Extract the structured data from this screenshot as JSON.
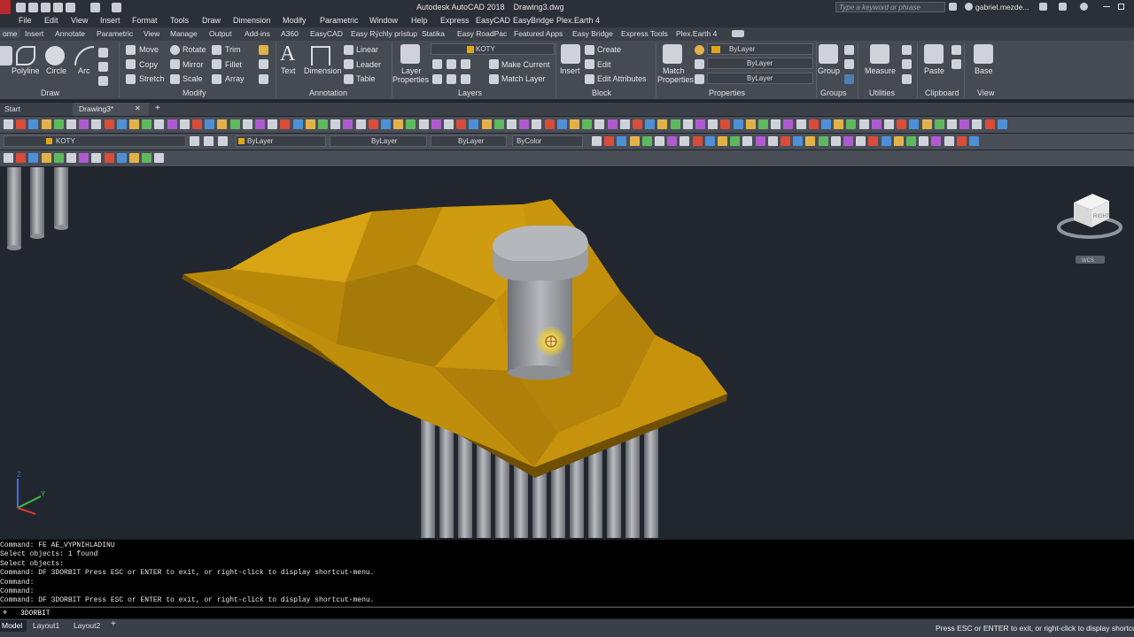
{
  "window": {
    "title": "Autodesk AutoCAD 2018    Drawing3.dwg",
    "search_placeholder": "Type a keyword or phrase",
    "username": "gabriel.mezde..."
  },
  "menu": [
    "File",
    "Edit",
    "View",
    "Insert",
    "Format",
    "Tools",
    "Draw",
    "Dimension",
    "Modify",
    "Parametric",
    "Window",
    "Help",
    "Express",
    "EasyCAD",
    "EasyBridge",
    "Plex.Earth 4"
  ],
  "ribbon_tabs": [
    "ome",
    "Insert",
    "Annotate",
    "Parametric",
    "View",
    "Manage",
    "Output",
    "Add-ins",
    "A360",
    "EasyCAD",
    "Easy Rýchly prístup",
    "Statika",
    "Easy RoadPac",
    "Featured Apps",
    "Easy Bridge",
    "Express Tools",
    "Plex.Earth 4"
  ],
  "ribbon": {
    "draw": {
      "polyline": "Polyline",
      "circle": "Circle",
      "arc": "Arc",
      "label": "Draw"
    },
    "modify": {
      "move": "Move",
      "rotate": "Rotate",
      "trim": "Trim",
      "copy": "Copy",
      "mirror": "Mirror",
      "fillet": "Fillet",
      "stretch": "Stretch",
      "scale": "Scale",
      "array": "Array",
      "label": "Modify"
    },
    "annotation": {
      "text": "Text",
      "dimension": "Dimension",
      "linear": "Linear",
      "leader": "Leader",
      "table": "Table",
      "label": "Annotation"
    },
    "layers": {
      "layer_properties_1": "Layer",
      "layer_properties_2": "Properties",
      "current_layer": "KOTY",
      "make_current": "Make Current",
      "match_layer": "Match Layer",
      "label": "Layers"
    },
    "block": {
      "insert": "Insert",
      "create": "Create",
      "edit": "Edit",
      "edit_attributes": "Edit Attributes",
      "label": "Block"
    },
    "properties": {
      "match_1": "Match",
      "match_2": "Properties",
      "color": "ByLayer",
      "linetype": "ByLayer",
      "lineweight": "ByLayer",
      "label": "Properties"
    },
    "groups": {
      "group": "Group",
      "label": "Groups"
    },
    "utilities": {
      "measure": "Measure",
      "label": "Utilities"
    },
    "clipboard": {
      "paste": "Paste",
      "label": "Clipboard"
    },
    "view": {
      "base": "Base",
      "label": "View"
    }
  },
  "doc_tabs": {
    "start": "Start",
    "drawing": "Drawing3*"
  },
  "toolbar2": {
    "layer": "KOTY",
    "color": "ByLayer",
    "linetype": "ByLayer",
    "lineweight": "ByLayer",
    "plotstyle": "ByColor"
  },
  "viewcube": {
    "face": "RIGHT",
    "wcs": "WCS"
  },
  "ucs": {
    "z": "Z",
    "y": "Y"
  },
  "command_history": [
    "Command: FE AE_VYPNIHLADINU",
    "Select objects: 1 found",
    "Select objects:",
    "Command: DF 3DORBIT Press ESC or ENTER to exit, or right-click to display shortcut-menu.",
    "Command:",
    "Command:",
    "Command: DF 3DORBIT Press ESC or ENTER to exit, or right-click to display shortcut-menu."
  ],
  "command_input": "3DORBIT",
  "layout_tabs": [
    "Model",
    "Layout1",
    "Layout2"
  ],
  "status_message": "Press ESC or ENTER to exit, or right-click to display shortcut-m",
  "colors": {
    "terrain": "#c8950c",
    "background": "#22262f",
    "ribbon": "#454a53"
  }
}
